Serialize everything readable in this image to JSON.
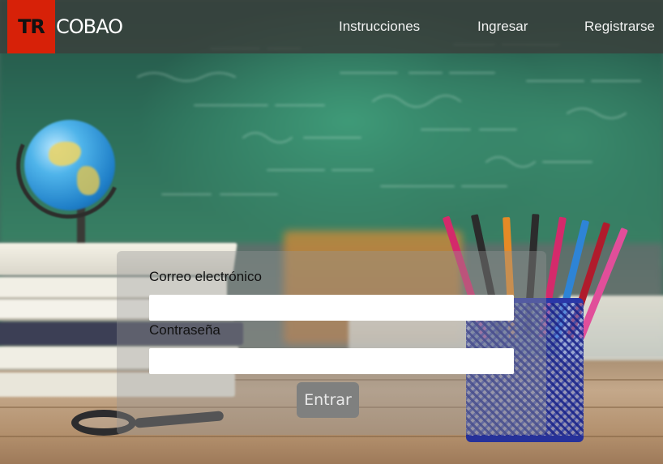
{
  "navbar": {
    "brand_mark": "TR",
    "brand_name": "COBAO",
    "links": [
      "Instrucciones",
      "Ingresar",
      "Registrarse"
    ]
  },
  "login": {
    "email_label": "Correo electrónico",
    "email_value": "",
    "password_label": "Contraseña",
    "password_value": "",
    "submit_label": "Entrar"
  },
  "colors": {
    "brand_accent": "#d72108",
    "navbar_bg": "#3a403c",
    "button_bg": "#7f807f"
  }
}
